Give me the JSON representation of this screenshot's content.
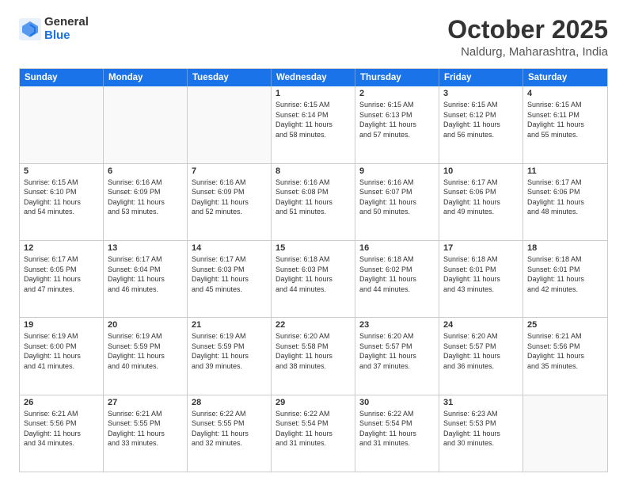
{
  "logo": {
    "general": "General",
    "blue": "Blue"
  },
  "title": {
    "month": "October 2025",
    "location": "Naldurg, Maharashtra, India"
  },
  "header_days": [
    "Sunday",
    "Monday",
    "Tuesday",
    "Wednesday",
    "Thursday",
    "Friday",
    "Saturday"
  ],
  "weeks": [
    [
      {
        "day": "",
        "text": ""
      },
      {
        "day": "",
        "text": ""
      },
      {
        "day": "",
        "text": ""
      },
      {
        "day": "1",
        "text": "Sunrise: 6:15 AM\nSunset: 6:14 PM\nDaylight: 11 hours\nand 58 minutes."
      },
      {
        "day": "2",
        "text": "Sunrise: 6:15 AM\nSunset: 6:13 PM\nDaylight: 11 hours\nand 57 minutes."
      },
      {
        "day": "3",
        "text": "Sunrise: 6:15 AM\nSunset: 6:12 PM\nDaylight: 11 hours\nand 56 minutes."
      },
      {
        "day": "4",
        "text": "Sunrise: 6:15 AM\nSunset: 6:11 PM\nDaylight: 11 hours\nand 55 minutes."
      }
    ],
    [
      {
        "day": "5",
        "text": "Sunrise: 6:15 AM\nSunset: 6:10 PM\nDaylight: 11 hours\nand 54 minutes."
      },
      {
        "day": "6",
        "text": "Sunrise: 6:16 AM\nSunset: 6:09 PM\nDaylight: 11 hours\nand 53 minutes."
      },
      {
        "day": "7",
        "text": "Sunrise: 6:16 AM\nSunset: 6:09 PM\nDaylight: 11 hours\nand 52 minutes."
      },
      {
        "day": "8",
        "text": "Sunrise: 6:16 AM\nSunset: 6:08 PM\nDaylight: 11 hours\nand 51 minutes."
      },
      {
        "day": "9",
        "text": "Sunrise: 6:16 AM\nSunset: 6:07 PM\nDaylight: 11 hours\nand 50 minutes."
      },
      {
        "day": "10",
        "text": "Sunrise: 6:17 AM\nSunset: 6:06 PM\nDaylight: 11 hours\nand 49 minutes."
      },
      {
        "day": "11",
        "text": "Sunrise: 6:17 AM\nSunset: 6:06 PM\nDaylight: 11 hours\nand 48 minutes."
      }
    ],
    [
      {
        "day": "12",
        "text": "Sunrise: 6:17 AM\nSunset: 6:05 PM\nDaylight: 11 hours\nand 47 minutes."
      },
      {
        "day": "13",
        "text": "Sunrise: 6:17 AM\nSunset: 6:04 PM\nDaylight: 11 hours\nand 46 minutes."
      },
      {
        "day": "14",
        "text": "Sunrise: 6:17 AM\nSunset: 6:03 PM\nDaylight: 11 hours\nand 45 minutes."
      },
      {
        "day": "15",
        "text": "Sunrise: 6:18 AM\nSunset: 6:03 PM\nDaylight: 11 hours\nand 44 minutes."
      },
      {
        "day": "16",
        "text": "Sunrise: 6:18 AM\nSunset: 6:02 PM\nDaylight: 11 hours\nand 44 minutes."
      },
      {
        "day": "17",
        "text": "Sunrise: 6:18 AM\nSunset: 6:01 PM\nDaylight: 11 hours\nand 43 minutes."
      },
      {
        "day": "18",
        "text": "Sunrise: 6:18 AM\nSunset: 6:01 PM\nDaylight: 11 hours\nand 42 minutes."
      }
    ],
    [
      {
        "day": "19",
        "text": "Sunrise: 6:19 AM\nSunset: 6:00 PM\nDaylight: 11 hours\nand 41 minutes."
      },
      {
        "day": "20",
        "text": "Sunrise: 6:19 AM\nSunset: 5:59 PM\nDaylight: 11 hours\nand 40 minutes."
      },
      {
        "day": "21",
        "text": "Sunrise: 6:19 AM\nSunset: 5:59 PM\nDaylight: 11 hours\nand 39 minutes."
      },
      {
        "day": "22",
        "text": "Sunrise: 6:20 AM\nSunset: 5:58 PM\nDaylight: 11 hours\nand 38 minutes."
      },
      {
        "day": "23",
        "text": "Sunrise: 6:20 AM\nSunset: 5:57 PM\nDaylight: 11 hours\nand 37 minutes."
      },
      {
        "day": "24",
        "text": "Sunrise: 6:20 AM\nSunset: 5:57 PM\nDaylight: 11 hours\nand 36 minutes."
      },
      {
        "day": "25",
        "text": "Sunrise: 6:21 AM\nSunset: 5:56 PM\nDaylight: 11 hours\nand 35 minutes."
      }
    ],
    [
      {
        "day": "26",
        "text": "Sunrise: 6:21 AM\nSunset: 5:56 PM\nDaylight: 11 hours\nand 34 minutes."
      },
      {
        "day": "27",
        "text": "Sunrise: 6:21 AM\nSunset: 5:55 PM\nDaylight: 11 hours\nand 33 minutes."
      },
      {
        "day": "28",
        "text": "Sunrise: 6:22 AM\nSunset: 5:55 PM\nDaylight: 11 hours\nand 32 minutes."
      },
      {
        "day": "29",
        "text": "Sunrise: 6:22 AM\nSunset: 5:54 PM\nDaylight: 11 hours\nand 31 minutes."
      },
      {
        "day": "30",
        "text": "Sunrise: 6:22 AM\nSunset: 5:54 PM\nDaylight: 11 hours\nand 31 minutes."
      },
      {
        "day": "31",
        "text": "Sunrise: 6:23 AM\nSunset: 5:53 PM\nDaylight: 11 hours\nand 30 minutes."
      },
      {
        "day": "",
        "text": ""
      }
    ]
  ]
}
